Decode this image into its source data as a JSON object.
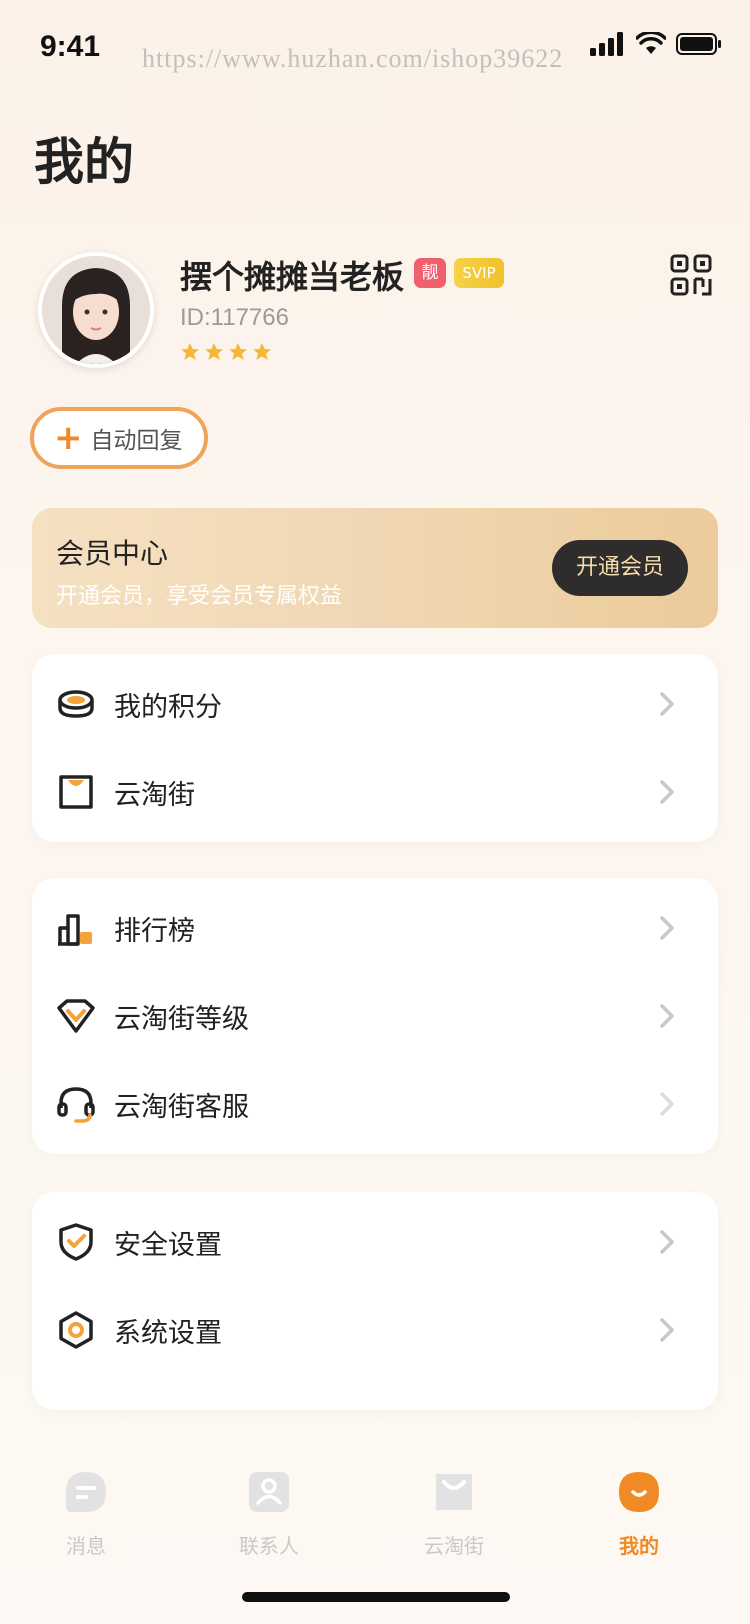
{
  "status_bar": {
    "time": "9:41"
  },
  "watermark": "https://www.huzhan.com/ishop39622",
  "page_title": "我的",
  "profile": {
    "username": "摆个摊摊当老板",
    "badge_liang": "靓",
    "badge_svip": "SVIP",
    "user_id": "ID:117766",
    "star_count": 4
  },
  "auto_reply": {
    "label": "自动回复"
  },
  "vip": {
    "title": "会员中心",
    "subtitle": "开通会员，享受会员专属权益",
    "button": "开通会员"
  },
  "menu_groups": [
    [
      {
        "label": "我的积分",
        "icon": "coin-icon"
      },
      {
        "label": "云淘街",
        "icon": "shop-bag-icon"
      }
    ],
    [
      {
        "label": "排行榜",
        "icon": "ranking-icon"
      },
      {
        "label": "云淘街等级",
        "icon": "diamond-icon"
      },
      {
        "label": "云淘街客服",
        "icon": "headset-icon"
      }
    ],
    [
      {
        "label": "安全设置",
        "icon": "shield-icon"
      },
      {
        "label": "系统设置",
        "icon": "settings-hex-icon"
      }
    ]
  ],
  "tabbar": {
    "items": [
      {
        "label": "消息",
        "icon": "message-icon"
      },
      {
        "label": "联系人",
        "icon": "contacts-icon"
      },
      {
        "label": "云淘街",
        "icon": "shop-bag-icon"
      },
      {
        "label": "我的",
        "icon": "profile-icon"
      }
    ],
    "active_index": 3,
    "active_color": "#f08a24",
    "inactive_color": "#c9c9c9"
  },
  "colors": {
    "accent": "#f08a24",
    "vip_button_bg": "#2f2d2b"
  }
}
